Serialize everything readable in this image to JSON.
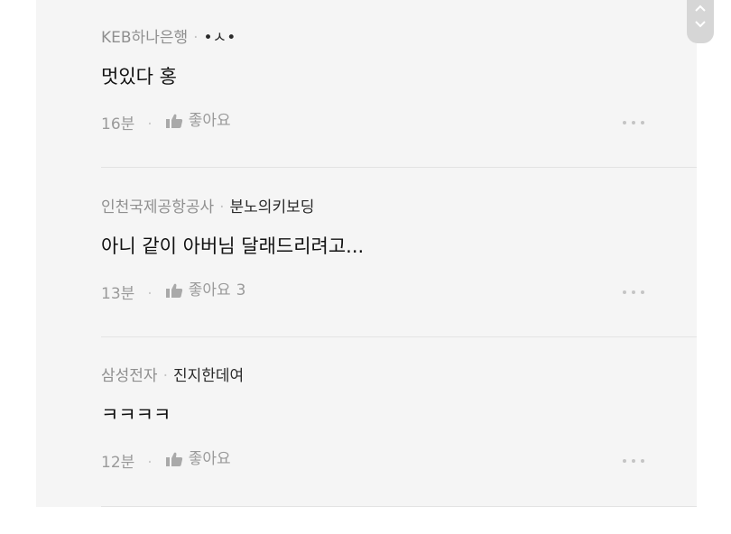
{
  "comments": [
    {
      "company": "KEB하나은행",
      "nickname": "•ㅅ•",
      "text": "멋있다 홍",
      "time": "16분",
      "like_label": "좋아요",
      "like_count": ""
    },
    {
      "company": "인천국제공항공사",
      "nickname": "분노의키보딩",
      "text": "아니 같이 아버님 달래드리려고...",
      "time": "13분",
      "like_label": "좋아요",
      "like_count": "3"
    },
    {
      "company": "삼성전자",
      "nickname": "진지한데여",
      "text": "ㅋㅋㅋㅋ",
      "time": "12분",
      "like_label": "좋아요",
      "like_count": ""
    }
  ],
  "icons": {
    "like": "thumbs-up-icon",
    "more": "more-dots-icon",
    "scroll_up": "chevron-up-icon",
    "scroll_down": "chevron-down-icon"
  },
  "colors": {
    "panel_bg": "#f5f5f5",
    "divider": "#e3e3e3",
    "meta_text": "#9a9a9a",
    "nickname_text": "#2a2a2a",
    "body_text": "#111111"
  }
}
